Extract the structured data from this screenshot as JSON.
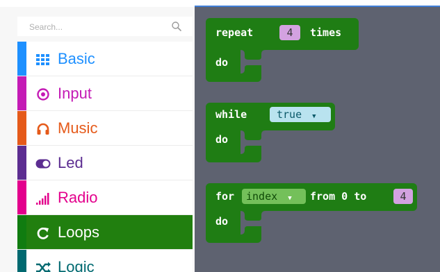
{
  "search": {
    "placeholder": "Search..."
  },
  "categories": [
    {
      "label": "Basic",
      "color": "#1e90ff",
      "icon": "grid-icon"
    },
    {
      "label": "Input",
      "color": "#c41bb5",
      "icon": "target-icon"
    },
    {
      "label": "Music",
      "color": "#e55a1a",
      "icon": "headphones-icon"
    },
    {
      "label": "Led",
      "color": "#5c2d91",
      "icon": "toggle-icon"
    },
    {
      "label": "Radio",
      "color": "#e3008c",
      "icon": "signal-bars-icon"
    },
    {
      "label": "Loops",
      "color": "#107c10",
      "icon": "refresh-icon",
      "selected": true
    },
    {
      "label": "Logic",
      "color": "#006970",
      "icon": "shuffle-icon"
    }
  ],
  "blocks": {
    "repeat": {
      "keyword": "repeat",
      "count": "4",
      "suffix": "times",
      "do": "do"
    },
    "while": {
      "keyword": "while",
      "condition": "true",
      "do": "do"
    },
    "for": {
      "keyword": "for",
      "variable": "index",
      "from": "from 0 to",
      "to": "4",
      "do": "do"
    }
  },
  "colors": {
    "loop_block": "#1f7d14",
    "workspace": "#5e6270",
    "number_slot": "#d3a2e0",
    "boolean_slot": "#b9e3ef",
    "variable_slot": "#74c05a"
  }
}
